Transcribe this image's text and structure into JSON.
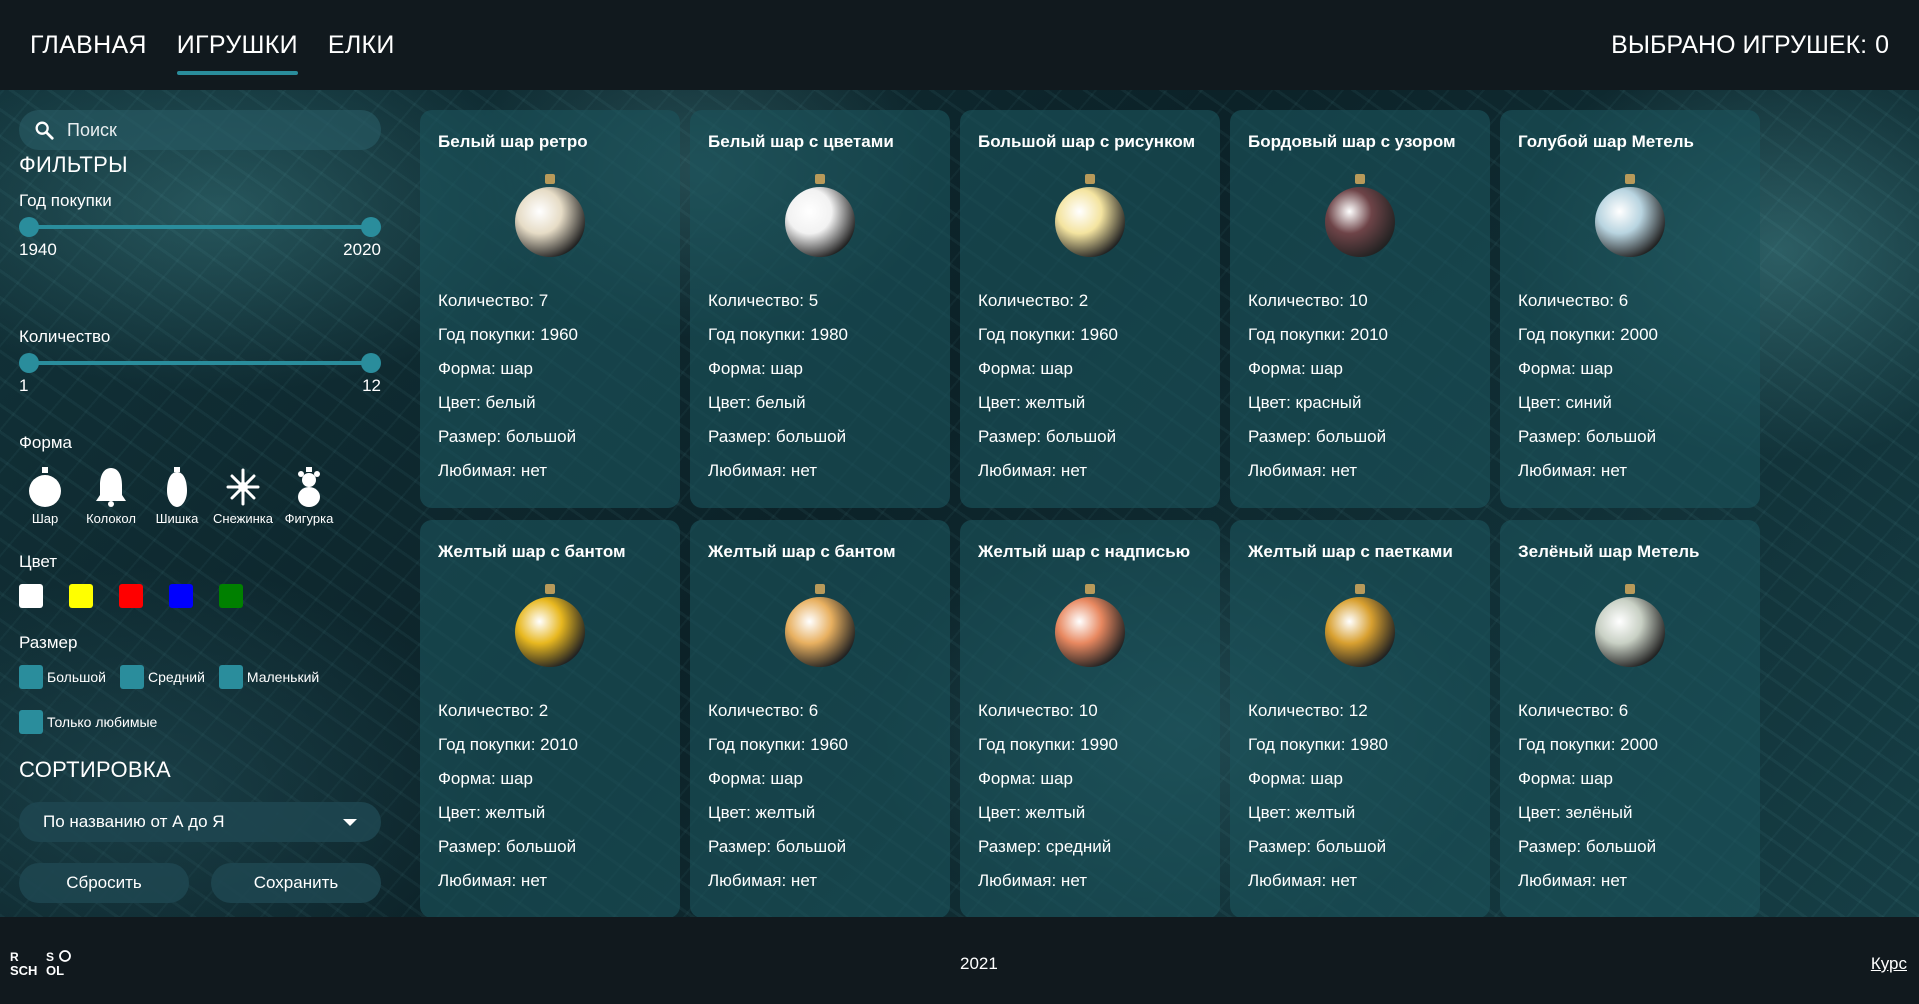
{
  "nav": {
    "home": "ГЛАВНАЯ",
    "toys": "ИГРУШКИ",
    "trees": "ЕЛКИ"
  },
  "counter": {
    "label": "ВЫБРАНО ИГРУШЕК:",
    "value": "0"
  },
  "search": {
    "placeholder": "Поиск"
  },
  "filters": {
    "title": "ФИЛЬТРЫ",
    "year": {
      "label": "Год покупки",
      "min": "1940",
      "max": "2020"
    },
    "count": {
      "label": "Количество",
      "min": "1",
      "max": "12"
    },
    "shape": {
      "label": "Форма",
      "items": [
        "Шар",
        "Колокол",
        "Шишка",
        "Снежинка",
        "Фигурка"
      ]
    },
    "color": {
      "label": "Цвет",
      "items": [
        "#ffffff",
        "#ffff00",
        "#ff0000",
        "#0000ff",
        "#008000"
      ]
    },
    "size": {
      "label": "Размер",
      "items": [
        "Большой",
        "Средний",
        "Маленький"
      ]
    },
    "favorite": "Только любимые"
  },
  "sort": {
    "title": "СОРТИРОВКА",
    "selected": "По названию от А до Я"
  },
  "buttons": {
    "reset": "Сбросить",
    "save": "Сохранить"
  },
  "cards": [
    {
      "title": "Белый шар ретро",
      "count": "Количество: 7",
      "year": "Год покупки: 1960",
      "shape": "Форма: шар",
      "color": "Цвет: белый",
      "size": "Размер: большой",
      "fav": "Любимая: нет",
      "ball": "#e6dcc6"
    },
    {
      "title": "Белый шар с цветами",
      "count": "Количество: 5",
      "year": "Год покупки: 1980",
      "shape": "Форма: шар",
      "color": "Цвет: белый",
      "size": "Размер: большой",
      "fav": "Любимая: нет",
      "ball": "#f2f2f2"
    },
    {
      "title": "Большой шар с рисунком",
      "count": "Количество: 2",
      "year": "Год покупки: 1960",
      "shape": "Форма: шар",
      "color": "Цвет: желтый",
      "size": "Размер: большой",
      "fav": "Любимая: нет",
      "ball": "#f4e4a0"
    },
    {
      "title": "Бордовый шар с узором",
      "count": "Количество: 10",
      "year": "Год покупки: 2010",
      "shape": "Форма: шар",
      "color": "Цвет: красный",
      "size": "Размер: большой",
      "fav": "Любимая: нет",
      "ball": "#6e4448"
    },
    {
      "title": "Голубой шар Метель",
      "count": "Количество: 6",
      "year": "Год покупки: 2000",
      "shape": "Форма: шар",
      "color": "Цвет: синий",
      "size": "Размер: большой",
      "fav": "Любимая: нет",
      "ball": "#b8d4e0"
    },
    {
      "title": "Желтый шар с бантом",
      "count": "Количество: 2",
      "year": "Год покупки: 2010",
      "shape": "Форма: шар",
      "color": "Цвет: желтый",
      "size": "Размер: большой",
      "fav": "Любимая: нет",
      "ball": "#e8b820"
    },
    {
      "title": "Желтый шар с бантом",
      "count": "Количество: 6",
      "year": "Год покупки: 1960",
      "shape": "Форма: шар",
      "color": "Цвет: желтый",
      "size": "Размер: большой",
      "fav": "Любимая: нет",
      "ball": "#e8b060"
    },
    {
      "title": "Желтый шар с надписью",
      "count": "Количество: 10",
      "year": "Год покупки: 1990",
      "shape": "Форма: шар",
      "color": "Цвет: желтый",
      "size": "Размер: средний",
      "fav": "Любимая: нет",
      "ball": "#e88860"
    },
    {
      "title": "Желтый шар с паетками",
      "count": "Количество: 12",
      "year": "Год покупки: 1980",
      "shape": "Форма: шар",
      "color": "Цвет: желтый",
      "size": "Размер: большой",
      "fav": "Любимая: нет",
      "ball": "#d8a030"
    },
    {
      "title": "Зелёный шар Метель",
      "count": "Количество: 6",
      "year": "Год покупки: 2000",
      "shape": "Форма: шар",
      "color": "Цвет: зелёный",
      "size": "Размер: большой",
      "fav": "Любимая: нет",
      "ball": "#c8d0c4"
    }
  ],
  "footer": {
    "logo": "RS SCHOOL",
    "year": "2021",
    "course": "Курс"
  }
}
